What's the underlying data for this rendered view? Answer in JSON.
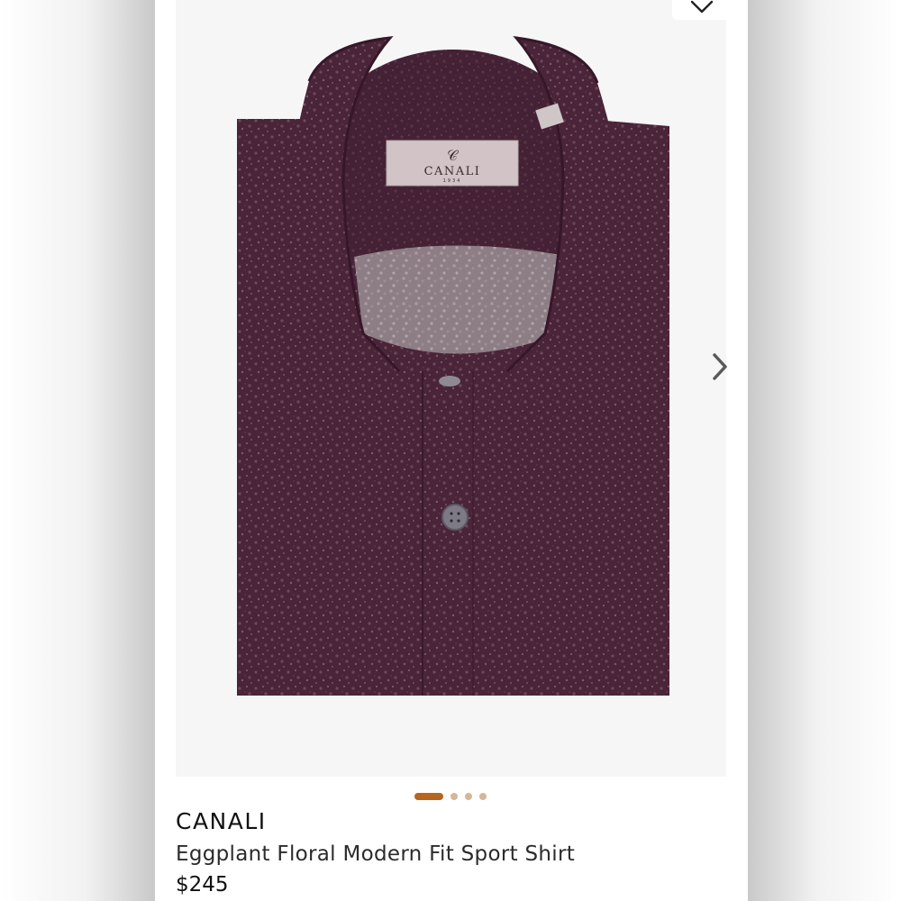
{
  "product": {
    "brand": "CANALI",
    "title": "Eggplant Floral Modern Fit Sport Shirt",
    "price": "$245",
    "label_brand": "CANALI",
    "label_year": "1934",
    "shirt_color": "#4a2438",
    "accent_color": "#b5651d"
  },
  "gallery": {
    "image_count": 4,
    "active_index": 0,
    "icons": [
      "heart-icon",
      "chevron-right-icon"
    ]
  }
}
